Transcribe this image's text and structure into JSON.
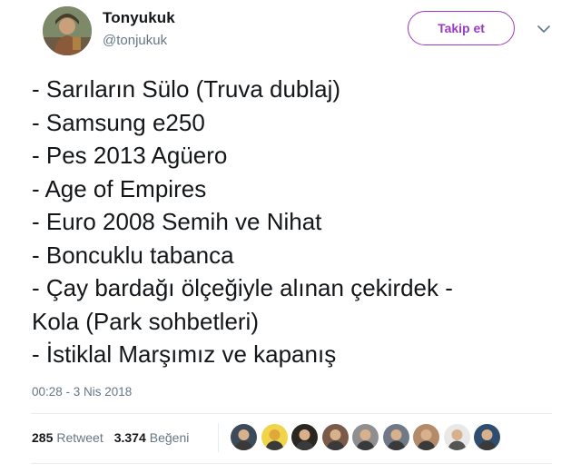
{
  "author": {
    "name": "Tonyukuk",
    "handle": "@tonjukuk"
  },
  "follow_button": {
    "label": "Takip et"
  },
  "tweet": {
    "lines": [
      "- Sarıların Sülo (Truva dublaj)",
      "- Samsung e250",
      "- Pes 2013 Agüero",
      "- Age of Empires",
      "- Euro 2008 Semih ve Nihat",
      "- Boncuklu tabanca",
      "- Çay bardağı ölçeğiyle alınan çekirdek -",
      "Kola (Park sohbetleri)",
      "- İstiklal Marşımız ve kapanış"
    ],
    "timestamp": "00:28 - 3 Nis 2018"
  },
  "stats": {
    "retweets_count": "285",
    "retweets_label": "Retweet",
    "likes_count": "3.374",
    "likes_label": "Beğeni"
  },
  "likers": [
    {
      "icon": "liker-avatar",
      "bg": "#3d4a5a"
    },
    {
      "icon": "liker-avatar",
      "bg": "#f0d44a"
    },
    {
      "icon": "liker-avatar",
      "bg": "#2b2620"
    },
    {
      "icon": "liker-avatar",
      "bg": "#7a5a48"
    },
    {
      "icon": "liker-avatar",
      "bg": "#8f8f8f"
    },
    {
      "icon": "liker-avatar",
      "bg": "#6f7a86"
    },
    {
      "icon": "liker-avatar",
      "bg": "#b38a6a"
    },
    {
      "icon": "liker-avatar",
      "bg": "#e8e8e8"
    },
    {
      "icon": "liker-avatar",
      "bg": "#2f4d6e"
    }
  ],
  "colors": {
    "accent": "#9b3bbf",
    "secondary_text": "#657786",
    "primary_text": "#14171a",
    "divider": "#e6ecf0"
  }
}
